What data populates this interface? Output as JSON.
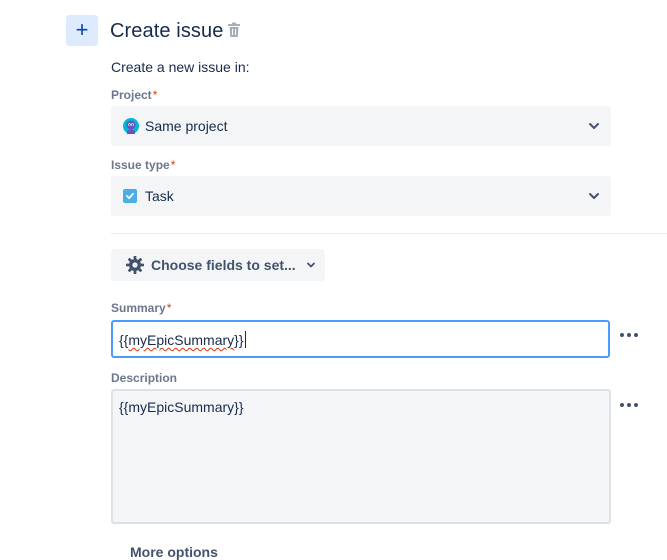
{
  "header": {
    "add_symbol": "+",
    "title": "Create issue"
  },
  "intro_text": "Create a new issue in:",
  "project": {
    "label": "Project",
    "required_mark": "*",
    "value": "Same project"
  },
  "issue_type": {
    "label": "Issue type",
    "required_mark": "*",
    "value": "Task"
  },
  "choose_fields": {
    "label": "Choose fields to set..."
  },
  "summary": {
    "label": "Summary",
    "required_mark": "*",
    "value_open": "{{",
    "value_word": "myEpicSummary",
    "value_close": "}}"
  },
  "description": {
    "label": "Description",
    "value": "{{myEpicSummary}}"
  },
  "footer": {
    "more_options": "More options"
  },
  "colors": {
    "accent": "#0052cc",
    "focus_border": "#4c9aff",
    "required": "#de350b",
    "field_bg": "#f4f5f7"
  },
  "icons": [
    "plus-icon",
    "trash-icon",
    "project-avatar-icon",
    "chevron-down-icon",
    "task-checkbox-icon",
    "gear-icon",
    "more-horizontal-icon"
  ]
}
